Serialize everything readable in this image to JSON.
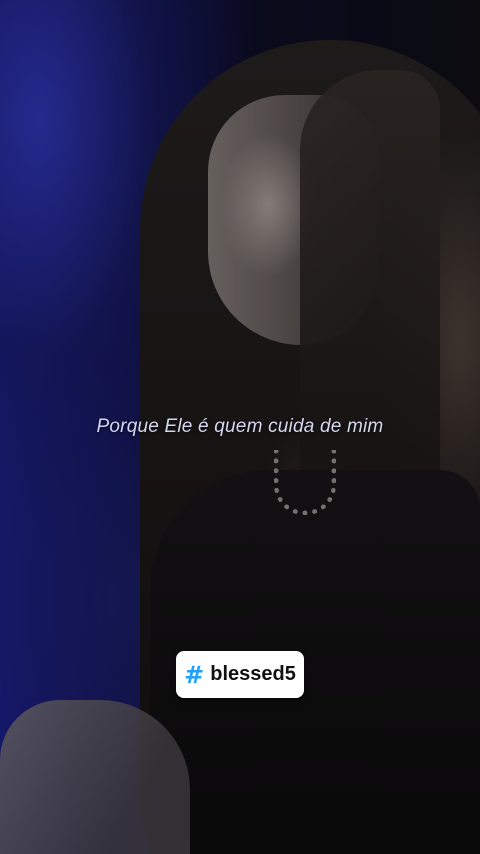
{
  "video": {
    "caption": "Porque Ele é quem cuida de mim"
  },
  "sticker": {
    "icon": "hash-icon",
    "symbol": "#",
    "tag": "blessed5",
    "icon_color": "#1fa0ff"
  }
}
